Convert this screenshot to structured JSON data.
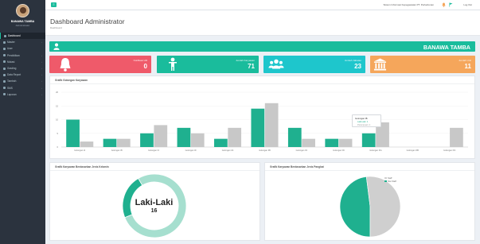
{
  "sidebar": {
    "user_name": "BANAWA TAMBA",
    "user_role": "Administrator",
    "items": [
      {
        "label": "Dashboard",
        "active": true
      },
      {
        "label": "Master",
        "chevron": true
      },
      {
        "label": "User",
        "chevron": false
      },
      {
        "label": "Pendidikan",
        "chevron": true
      },
      {
        "label": "Mutasi",
        "chevron": true
      },
      {
        "label": "Grading",
        "chevron": true
      },
      {
        "label": "Data Report",
        "chevron": true
      },
      {
        "label": "Tambah",
        "chevron": true
      },
      {
        "label": "SMS",
        "chevron": true
      },
      {
        "label": "Laporan",
        "chevron": true
      }
    ]
  },
  "topbar": {
    "toggle_icon": "≡",
    "info_text": "Sistem Informasi Kepegawaian PT. Perkebunan",
    "logout_label": "Log Out"
  },
  "header": {
    "title": "Dashboard Administrator",
    "subtitle": "Dashboard"
  },
  "banner": {
    "name": "BANAWA TAMBA",
    "icon": "user-icon"
  },
  "cards": [
    {
      "label": "Notifikasi HR",
      "value": "0",
      "color": "#ef5a6a",
      "icon": "bell-icon"
    },
    {
      "label": "Jumlah Karyawan",
      "value": "71",
      "color": "#1abc9c",
      "icon": "person-icon"
    },
    {
      "label": "Jumlah Jabatan",
      "value": "23",
      "color": "#1ec6cc",
      "icon": "group-icon"
    },
    {
      "label": "Jumlah Unit",
      "value": "11",
      "color": "#f5a65b",
      "icon": "bank-icon"
    }
  ],
  "bar_panel": {
    "title": "Grafik Golongan Karyawan"
  },
  "tooltip": {
    "title": "Golongan IB",
    "line1": "Laki-Laki: 1",
    "line2": "Perempuan: 1"
  },
  "donut_panel": {
    "title": "Grafik Karyawan Berdasarkan Jenis Kelamin",
    "center_label": "Laki-Laki",
    "center_value": "16"
  },
  "pie_panel": {
    "title": "Grafik Karyawan Berdasarkan Jenis Pangkat",
    "legend": [
      "Staff",
      "Non Staff"
    ]
  },
  "chart_data": [
    {
      "type": "bar",
      "categories": [
        "Golongan IA",
        "Golongan IB",
        "Golongan IC",
        "Golongan ID",
        "Golongan IIA",
        "Golongan IIB",
        "Golongan IIC",
        "Golongan IID",
        "Golongan IIIA",
        "Golongan IIIB",
        "Golongan IIIC"
      ],
      "series": [
        {
          "name": "Laki-Laki",
          "values": [
            10,
            3,
            5,
            7,
            3,
            14,
            7,
            3,
            5,
            0,
            0
          ],
          "color": "#1fb08f"
        },
        {
          "name": "Perempuan",
          "values": [
            2,
            3,
            8,
            5,
            7,
            16,
            3,
            3,
            9,
            0,
            7
          ],
          "color": "#c8c8c8"
        }
      ],
      "ylim": [
        0,
        20
      ],
      "yticks": [
        0,
        5,
        10,
        15,
        20
      ]
    },
    {
      "type": "pie",
      "variant": "donut",
      "labels": [
        "Laki-Laki",
        "Perempuan"
      ],
      "values": [
        16,
        55
      ],
      "colors": [
        "#1fb08f",
        "#a6dfcf"
      ]
    },
    {
      "type": "pie",
      "labels": [
        "Staff",
        "Non Staff"
      ],
      "values": [
        48,
        52
      ],
      "colors": [
        "#1fb08f",
        "#cfcfcf"
      ]
    }
  ]
}
